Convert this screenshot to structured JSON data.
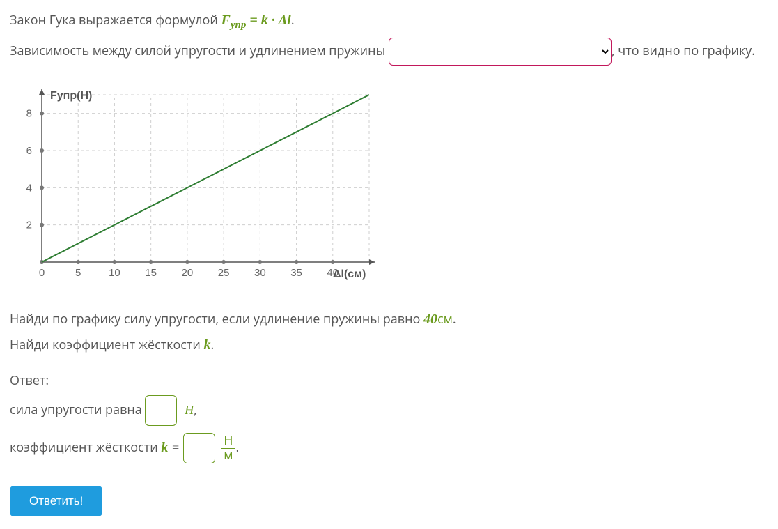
{
  "line1_pre": "Закон Гука выражается формулой ",
  "formula_F": "F",
  "formula_sub": "упр",
  "formula_eq": " = ",
  "formula_k": "k",
  "formula_dot": " · ",
  "formula_dl": "Δl",
  "line1_post": ".",
  "line2_pre": "Зависимость между силой упругости и удлинением пружины ",
  "line2_post": ", что видно по графику.",
  "dropdown_options": [
    ""
  ],
  "task_find_force_pre": "Найди по графику силу упругости, если удлинение пружины равно ",
  "task_find_force_val": "40",
  "task_find_force_unit": "см",
  "task_find_force_post": ".",
  "task_find_k_pre": "Найди коэффициент жёсткости ",
  "task_find_k_sym": "k",
  "task_find_k_post": ".",
  "answer_label": "Ответ:",
  "ans_force_pre": "сила упругости равна ",
  "ans_force_unit": "Н",
  "ans_force_post": ",",
  "ans_k_pre": "коэффициент жёсткости ",
  "ans_k_sym": "k",
  "ans_k_eq": " = ",
  "ans_k_unit_num": "Н",
  "ans_k_unit_den": "м",
  "ans_k_post": ".",
  "submit_label": "Ответить!",
  "chart_data": {
    "type": "line",
    "ylabel": "Fупр(Н)",
    "xlabel": "Δl(см)",
    "x_ticks": [
      0,
      5,
      10,
      15,
      20,
      25,
      30,
      35,
      40
    ],
    "y_ticks": [
      0,
      2,
      4,
      6,
      8
    ],
    "xlim": [
      0,
      45
    ],
    "ylim": [
      0,
      9
    ],
    "series": [
      {
        "name": "line",
        "points": [
          [
            0,
            0
          ],
          [
            45,
            9
          ]
        ]
      }
    ]
  }
}
